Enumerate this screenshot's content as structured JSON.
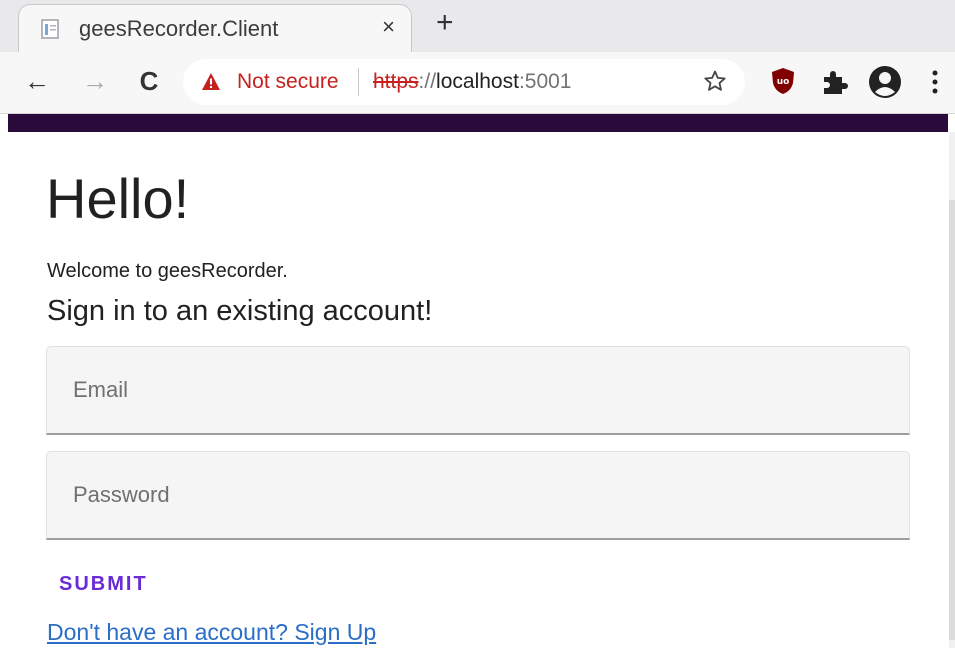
{
  "browser": {
    "tab": {
      "title": "geesRecorder.Client",
      "close_glyph": "×"
    },
    "new_tab_glyph": "+",
    "nav": {
      "back_glyph": "←",
      "forward_glyph": "→",
      "reload_glyph": "C"
    },
    "omnibox": {
      "security_label": "Not secure",
      "url_scheme": "https",
      "url_separator": "://",
      "url_host": "localhost",
      "url_port": ":5001"
    },
    "icons": [
      "page-icon",
      "warning-icon",
      "star-icon",
      "ublock-icon",
      "extensions-puzzle-icon",
      "profile-icon",
      "menu-kebab-icon"
    ]
  },
  "colors": {
    "appbar": "#2a0a3a",
    "submit": "#6a2bd6",
    "link": "#2a6ec7",
    "not_secure": "#c5221f"
  },
  "page": {
    "heading": "Hello!",
    "welcome": "Welcome to geesRecorder.",
    "subheading": "Sign in to an existing account!",
    "form": {
      "email_placeholder": "Email",
      "email_value": "",
      "password_placeholder": "Password",
      "password_value": "",
      "submit_label": "SUBMIT"
    },
    "signup_link": "Don't have an account? Sign Up"
  }
}
